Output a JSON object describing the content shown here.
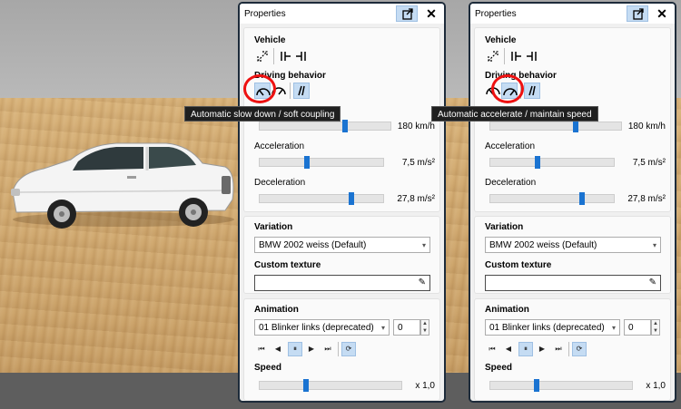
{
  "panels": [
    {
      "title": "Properties",
      "vehicle_heading": "Vehicle",
      "driving_heading": "Driving behavior",
      "speed_value": "180 km/h",
      "speed_level": 0.65,
      "acceleration_label": "Acceleration",
      "acceleration_value": "7,5 m/s²",
      "acceleration_level": 0.38,
      "deceleration_label": "Deceleration",
      "deceleration_value": "27,8 m/s²",
      "deceleration_level": 0.74,
      "variation_heading": "Variation",
      "variation_selected": "BMW 2002 weiss (Default)",
      "custom_texture_heading": "Custom texture",
      "custom_texture_value": "",
      "animation_heading": "Animation",
      "animation_selected": "01  Blinker links (deprecated)",
      "animation_index": "0",
      "anim_speed_heading": "Speed",
      "anim_speed_value": "x 1,0",
      "anim_speed_level": 0.33,
      "tooltip": "Automatic slow down / soft coupling",
      "active_behavior": "slow-down"
    },
    {
      "title": "Properties",
      "vehicle_heading": "Vehicle",
      "driving_heading": "Driving behavior",
      "speed_value": "180 km/h",
      "speed_level": 0.65,
      "acceleration_label": "Acceleration",
      "acceleration_value": "7,5 m/s²",
      "acceleration_level": 0.38,
      "deceleration_label": "Deceleration",
      "deceleration_value": "27,8 m/s²",
      "deceleration_level": 0.74,
      "variation_heading": "Variation",
      "variation_selected": "BMW 2002 weiss (Default)",
      "custom_texture_heading": "Custom texture",
      "custom_texture_value": "",
      "animation_heading": "Animation",
      "animation_selected": "01  Blinker links (deprecated)",
      "animation_index": "0",
      "anim_speed_heading": "Speed",
      "anim_speed_value": "x 1,0",
      "anim_speed_level": 0.33,
      "tooltip": "Automatic accelerate / maintain speed",
      "active_behavior": "accelerate"
    }
  ],
  "icons": {
    "popout": "popout-icon",
    "close": "close-icon",
    "vehicle": [
      "resize-icon",
      "couple-left-icon",
      "couple-right-icon"
    ],
    "behavior": [
      "slow-down-gauge-icon",
      "accelerate-gauge-icon",
      "drive-lane-icon"
    ],
    "playback": [
      "skip-first-icon",
      "step-back-icon",
      "pause-icon",
      "play-icon",
      "skip-last-icon",
      "loop-icon"
    ]
  },
  "colors": {
    "accent": "#1a73d1",
    "selected_bg": "#c5dcf3",
    "highlight_ring": "#e11111",
    "panel_border": "#1d2b3a"
  }
}
